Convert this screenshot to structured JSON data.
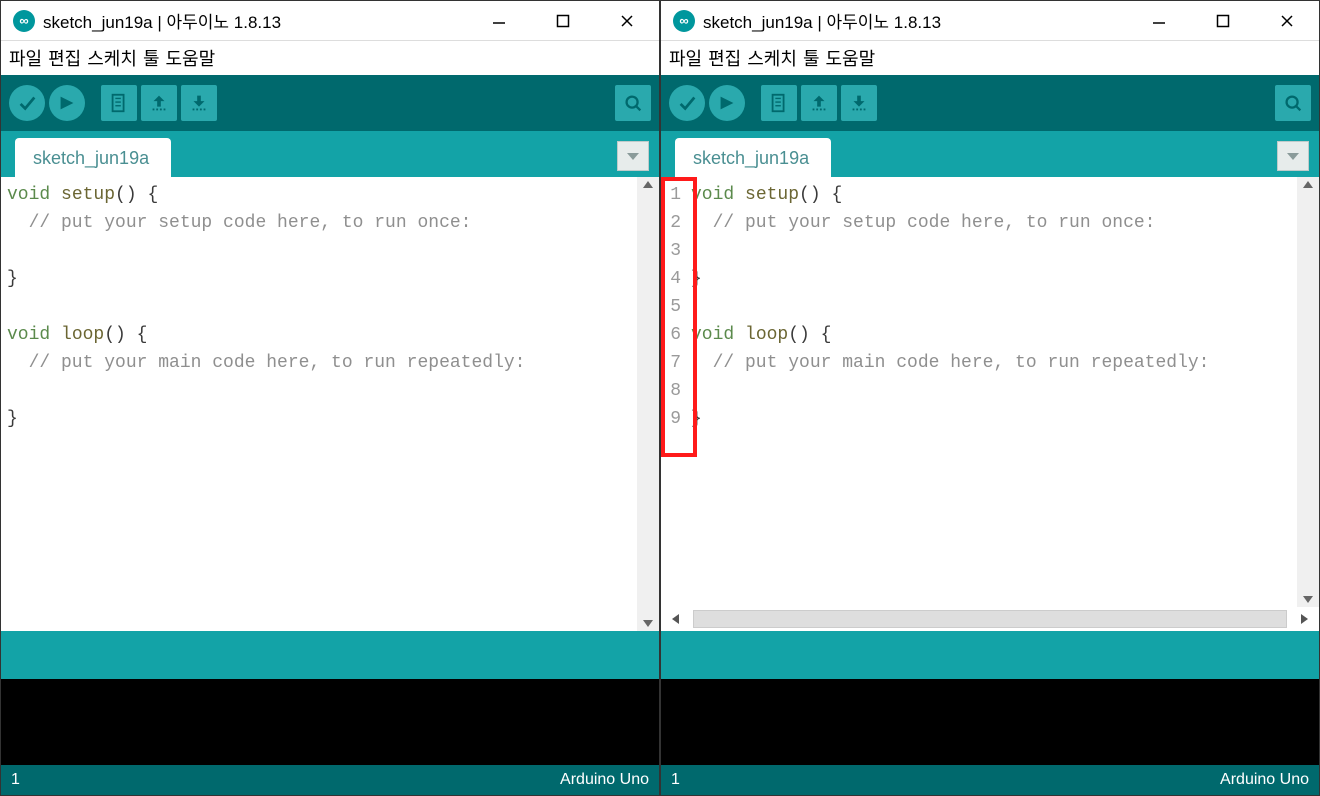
{
  "title": "sketch_jun19a | 아두이노 1.8.13",
  "menu": {
    "file": "파일",
    "edit": "편집",
    "sketch": "스케치",
    "tools": "툴",
    "help": "도움말"
  },
  "tab": "sketch_jun19a",
  "code_lines": [
    {
      "t": "fn_decl",
      "kw": "void",
      "fn": "setup",
      "rest": "() {"
    },
    {
      "t": "comment",
      "text": "  // put your setup code here, to run once:"
    },
    {
      "t": "blank"
    },
    {
      "t": "plain",
      "text": "}"
    },
    {
      "t": "blank"
    },
    {
      "t": "fn_decl",
      "kw": "void",
      "fn": "loop",
      "rest": "() {"
    },
    {
      "t": "comment",
      "text": "  // put your main code here, to run repeatedly:"
    },
    {
      "t": "blank"
    },
    {
      "t": "plain",
      "text": "}"
    }
  ],
  "status": {
    "line": "1",
    "board": "Arduino Uno"
  },
  "right_window": {
    "show_line_numbers": true,
    "highlight_gutter": true
  }
}
